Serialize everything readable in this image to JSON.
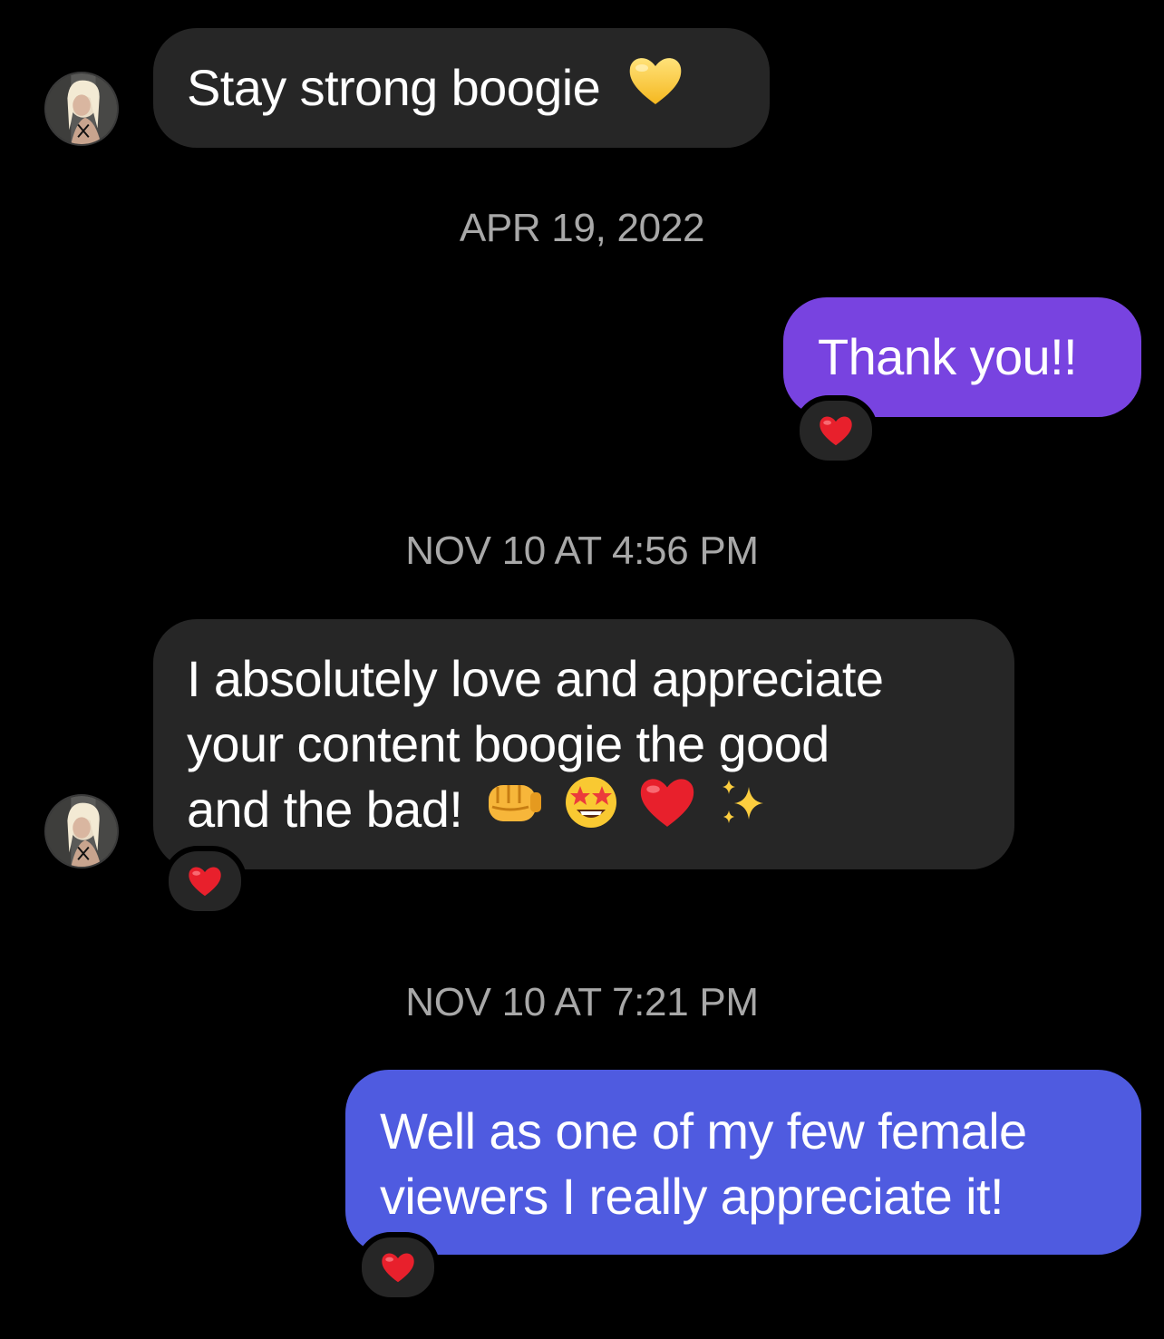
{
  "thread": {
    "messages": [
      {
        "direction": "incoming",
        "text": "Stay strong boogie",
        "emoji": [
          "yellow-heart"
        ]
      },
      {
        "type": "timestamp",
        "text": "APR 19, 2022"
      },
      {
        "direction": "outgoing",
        "text": "Thank you!!",
        "reaction": "red-heart"
      },
      {
        "type": "timestamp",
        "text": "NOV 10 AT 4:56 PM"
      },
      {
        "direction": "incoming",
        "lines": [
          "I absolutely love and appreciate",
          "your content boogie the good",
          "and the bad!"
        ],
        "emoji": [
          "oncoming-fist",
          "star-struck",
          "red-heart",
          "sparkles"
        ],
        "reaction": "red-heart"
      },
      {
        "type": "timestamp",
        "text": "NOV 10 AT 7:21 PM"
      },
      {
        "direction": "outgoing",
        "lines": [
          "Well as one of my few female",
          "viewers I really appreciate it!"
        ],
        "reaction": "red-heart"
      }
    ]
  },
  "colors": {
    "background": "#000000",
    "incoming_bubble": "#262626",
    "outgoing_bubble_top": "#7843e0",
    "outgoing_bubble_bottom": "#4f5be0",
    "timestamp_text": "#a8a8a8"
  }
}
